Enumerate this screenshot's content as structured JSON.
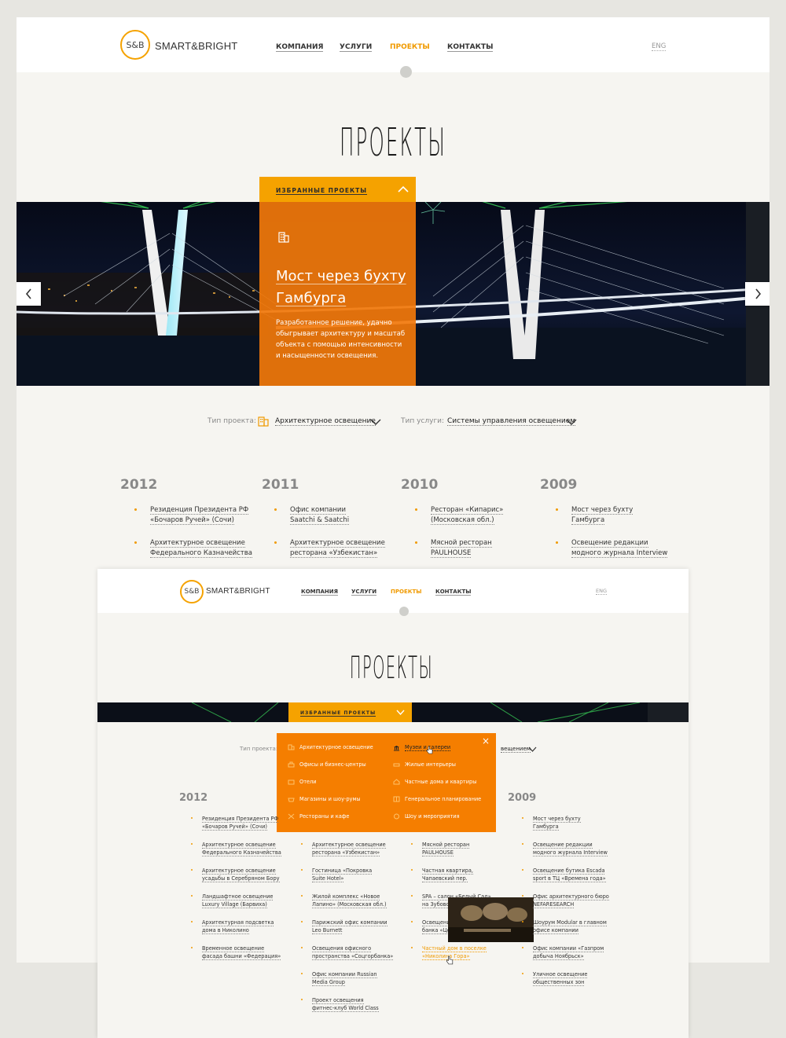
{
  "brand": {
    "mark": "S&B",
    "name": "SMART&BRIGHT"
  },
  "nav": {
    "items": [
      "КОМПАНИЯ",
      "УСЛУГИ",
      "ПРОЕКТЫ",
      "КОНТАКТЫ"
    ],
    "active": "ПРОЕКТЫ"
  },
  "lang": "ENG",
  "page_title": "ПРОЕКТЫ",
  "featured": {
    "tab_label": "ИЗБРАННЫЕ ПРОЕКТЫ",
    "icon": "building-icon",
    "title_line1": "Мост через бухту",
    "title_line2": "Гамбурга",
    "description": [
      "Разработанное решение, удачно",
      "обыгрывает архитектуру и масштаб",
      "объекта с помощью интенсивности",
      "и насыщенности освещения."
    ]
  },
  "filters": {
    "type_label": "Тип проекта:",
    "type_value": "Архитектурное освещение",
    "service_label": "Тип услуги:",
    "service_value": "Системы управления освещением",
    "service_value_partial": "вещением"
  },
  "years": [
    {
      "year": "2012",
      "projects": [
        [
          "Резиденция Президента РФ",
          "«Бочаров Ручей» (Сочи)"
        ],
        [
          "Архитектурное освещение",
          "Федерального Казначейства"
        ]
      ]
    },
    {
      "year": "2011",
      "projects": [
        [
          "Офис компании",
          "Saatchi & Saatchi"
        ],
        [
          "Архитектурное освещение",
          "ресторана «Узбекистан»"
        ]
      ]
    },
    {
      "year": "2010",
      "projects": [
        [
          "Ресторан «Кипарис»",
          "(Московская обл.)"
        ],
        [
          "Мясной ресторан",
          "PAULHOUSE"
        ]
      ]
    },
    {
      "year": "2009",
      "projects": [
        [
          "Мост через бухту",
          "Гамбурга"
        ],
        [
          "Освещение редакции",
          "модного журнала Interview"
        ]
      ]
    }
  ],
  "dropdown": {
    "left": [
      "Архитектурное освещение",
      "Офисы и бизнес-центры",
      "Отели",
      "Магазины и шоу-румы",
      "Рестораны и кафе"
    ],
    "right": [
      "Музеи и галереи",
      "Жилые интерьеры",
      "Частные дома и квартиры",
      "Генеральное планирование",
      "Шоу и мероприятия"
    ],
    "hovered": "Музеи и галереи",
    "close": "×"
  },
  "list2": {
    "col2012": {
      "year": "2012",
      "items": [
        [
          "Резиденция Президента РФ",
          "«Бочаров Ручей» (Сочи)"
        ],
        [
          "Архитектурное освещение",
          "Федерального Казначейства"
        ],
        [
          "Архитектурное освещение",
          "усадьбы в Серебряном Бору"
        ],
        [
          "Ландшафтное освещение",
          "Luxury Village (Барвиха)"
        ],
        [
          "Архитектурная подсветка",
          "дома в Николино"
        ],
        [
          "Временное освещение",
          "фасада башни «Федерация»"
        ]
      ]
    },
    "col2011": {
      "items": [
        [
          "Архитектурное освещение",
          "ресторана «Узбекистан»"
        ],
        [
          "Гостиница «Покровка",
          "Suite Hotel»"
        ],
        [
          "Жилой комплекс «Новое",
          "Лапино» (Московская обл.)"
        ],
        [
          "Парижский офис компании",
          "Leo Burnett"
        ],
        [
          "Освещения офисного",
          "пространства «Соцгорбанка»"
        ],
        [
          "Офис компании Russian",
          "Media Group"
        ],
        [
          "Проект освещения",
          "фитнес-клуб World Class"
        ]
      ]
    },
    "col2010": {
      "items": [
        [
          "Мясной ресторан",
          "PAULHOUSE"
        ],
        [
          "Частная квартира,",
          "Чапаевский пер."
        ],
        [
          "SPA – салон «Белый Сад»",
          "на Зубовском"
        ],
        [
          "Освещение",
          "банка «Це"
        ],
        [
          "Частный дом в поселке",
          "«Николина Гора»"
        ]
      ]
    },
    "col2009": {
      "year": "2009",
      "items": [
        [
          "Мост через бухту",
          "Гамбурга"
        ],
        [
          "Освещение редакции",
          "модного журнала Interview"
        ],
        [
          "Освещение бутика Escada",
          "sport в ТЦ «Времена года»"
        ],
        [
          "Офис архитектурного бюро",
          "NEFARESEARCH"
        ],
        [
          "Шоурум Modular в главном",
          "офисе компании"
        ],
        [
          "Офис компании «Газпром",
          "добыча Ноябрьск»"
        ],
        [
          "Уличное освещение",
          "общественных зон"
        ]
      ]
    }
  },
  "colors": {
    "accent": "#f5a200",
    "panel": "#f2780a",
    "background": "#f6f5f1"
  }
}
